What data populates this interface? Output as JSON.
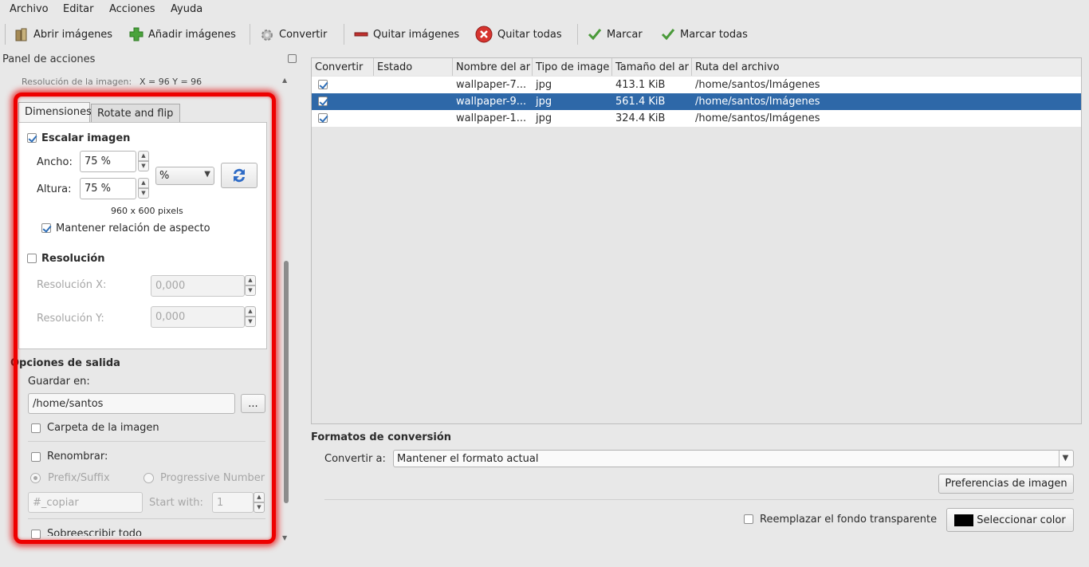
{
  "menu": [
    "Archivo",
    "Editar",
    "Acciones",
    "Ayuda"
  ],
  "toolbar": {
    "open": "Abrir imágenes",
    "add": "Añadir imágenes",
    "convert": "Convertir",
    "remove": "Quitar imágenes",
    "remove_all": "Quitar todas",
    "mark": "Marcar",
    "mark_all": "Marcar todas"
  },
  "actions_panel": {
    "title": "Panel de acciones",
    "resolution_info": "Resolución de la imagen:",
    "resolution_values": "X = 96 Y = 96",
    "tabs": [
      "Dimensiones",
      "Rotate and flip"
    ],
    "scale_label": "Escalar imagen",
    "width_label": "Ancho:",
    "width_value": "75 %",
    "height_label": "Altura:",
    "height_value": "75 %",
    "unit_value": "%",
    "size_text": "960 x 600 pixels",
    "keep_aspect_label": "Mantener relación de aspecto",
    "resolution_label": "Resolución",
    "res_x_label": "Resolución X:",
    "res_x_value": "0,000",
    "res_y_label": "Resolución Y:",
    "res_y_value": "0,000",
    "output_title": "Opciones de salida",
    "save_in_label": "Guardar en:",
    "save_in_value": "/home/santos",
    "browse_label": "...",
    "image_folder_label": "Carpeta de la imagen",
    "rename_label": "Renombrar:",
    "prefix_suffix_label": "Prefix/Suffix",
    "progressive_label": "Progressive Number",
    "rename_pattern": "#_copiar",
    "start_with_label": "Start with:",
    "start_with_value": "1",
    "overwrite_label": "Sobreescribir todo"
  },
  "table": {
    "headers": [
      "Convertir",
      "Estado",
      "Nombre del ar",
      "Tipo de image",
      "Tamaño del ar",
      "Ruta del archivo"
    ],
    "rows": [
      {
        "checked": true,
        "name": "wallpaper-7...",
        "type": "jpg",
        "size": "413.1 KiB",
        "path": "/home/santos/Imágenes"
      },
      {
        "checked": true,
        "name": "wallpaper-9...",
        "type": "jpg",
        "size": "561.4 KiB",
        "path": "/home/santos/Imágenes",
        "selected": true
      },
      {
        "checked": true,
        "name": "wallpaper-1...",
        "type": "jpg",
        "size": "324.4 KiB",
        "path": "/home/santos/Imágenes"
      }
    ]
  },
  "conversion": {
    "title": "Formatos de conversión",
    "convert_to_label": "Convertir a:",
    "convert_to_value": "Mantener el formato actual",
    "preferences_label": "Preferencias de imagen",
    "replace_bg_label": "Reemplazar el fondo transparente",
    "select_color_label": "Seleccionar color",
    "swatch_color": "#000000"
  }
}
